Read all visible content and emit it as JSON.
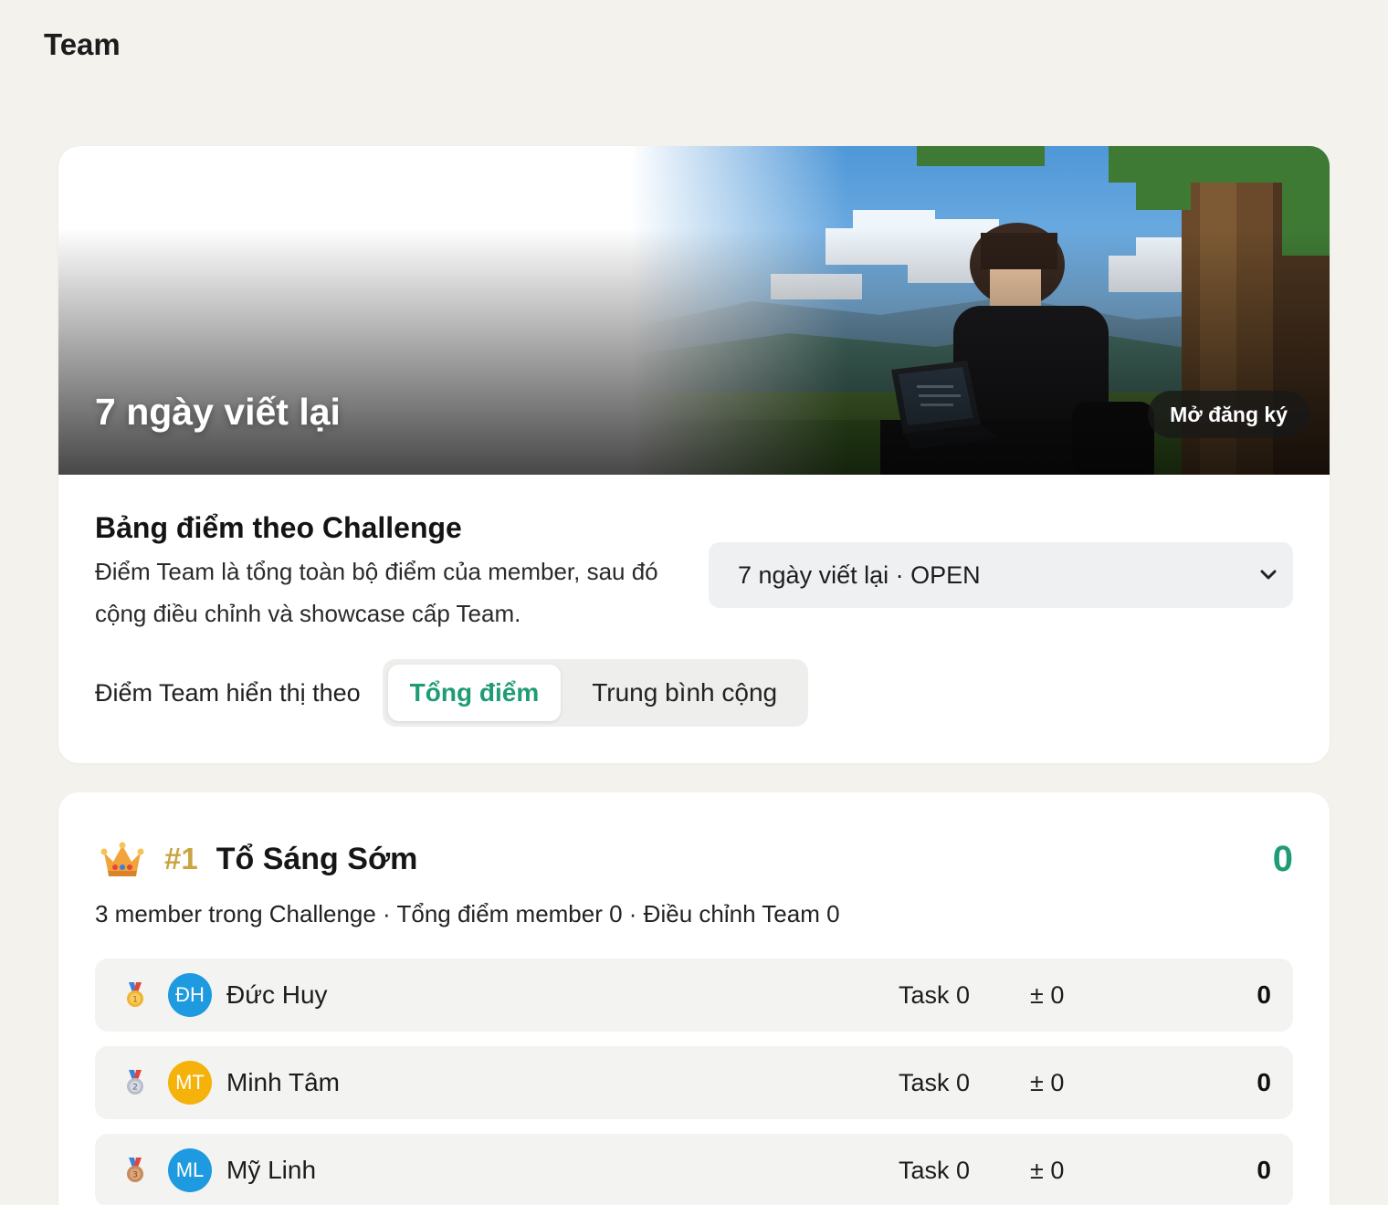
{
  "page": {
    "title": "Team"
  },
  "challenge": {
    "banner_title": "7 ngày viết lại",
    "status_badge": "Mở đăng ký"
  },
  "leaderboard": {
    "title": "Bảng điểm theo Challenge",
    "description": "Điểm Team là tổng toàn bộ điểm của member, sau đó cộng điều chỉnh và showcase cấp Team.",
    "selected_challenge": "7 ngày viết lại · OPEN",
    "display_mode_label": "Điểm Team hiển thị theo",
    "modes": [
      {
        "label": "Tổng điểm",
        "active": true
      },
      {
        "label": "Trung bình cộng",
        "active": false
      }
    ]
  },
  "team": {
    "rank": "#1",
    "name": "Tổ Sáng Sớm",
    "score": "0",
    "meta": "3 member trong Challenge · Tổng điểm member 0 · Điều chỉnh Team 0",
    "members": [
      {
        "initials": "ĐH",
        "name": "Đức Huy",
        "task": "Task 0",
        "adjust": "± 0",
        "score": "0",
        "avatar_color": "#1e9be0",
        "medal": "1"
      },
      {
        "initials": "MT",
        "name": "Minh Tâm",
        "task": "Task 0",
        "adjust": "± 0",
        "score": "0",
        "avatar_color": "#f4b20a",
        "medal": "2"
      },
      {
        "initials": "ML",
        "name": "Mỹ Linh",
        "task": "Task 0",
        "adjust": "± 0",
        "score": "0",
        "avatar_color": "#1e9be0",
        "medal": "3"
      }
    ]
  },
  "colors": {
    "accent": "#1f9c75",
    "rank_gold": "#c9a441",
    "page_bg": "#f4f2ec"
  }
}
